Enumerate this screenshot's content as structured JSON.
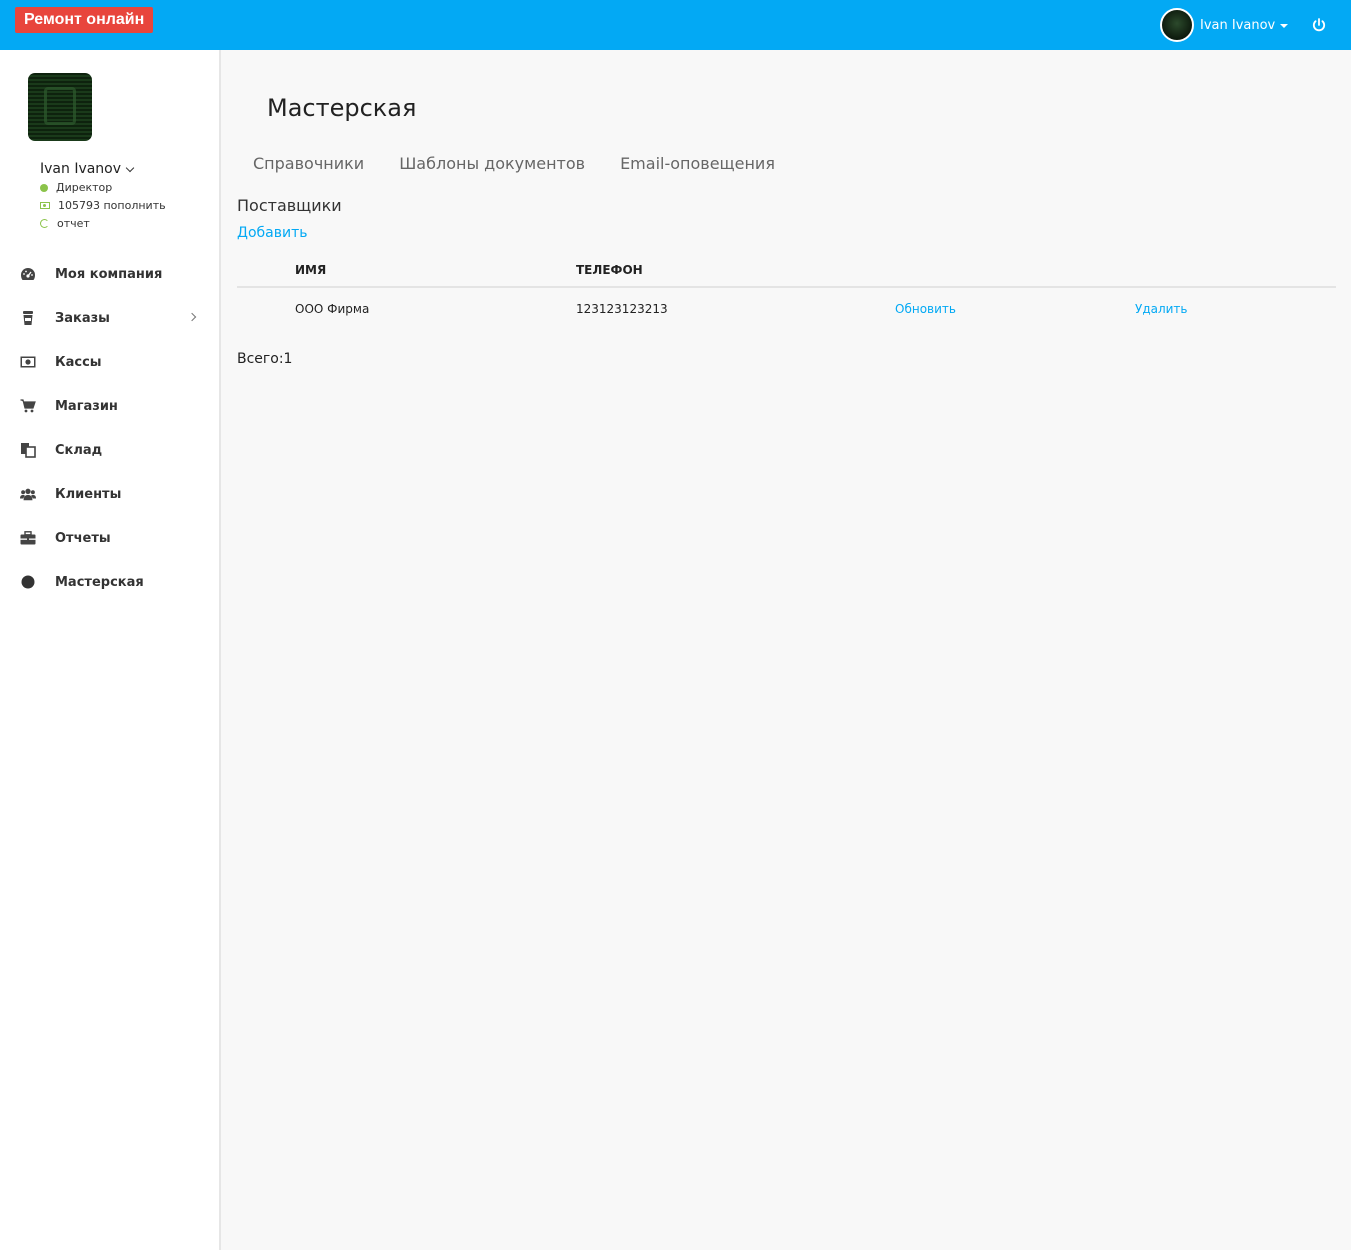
{
  "topbar": {
    "brand": "Ремонт онлайн",
    "user_name": "Ivan Ivanov"
  },
  "sidebar": {
    "user_name": "Ivan Ivanov",
    "role": "Директор",
    "balance": "105793 пополнить",
    "report": "отчет",
    "items": [
      {
        "label": "Моя компания",
        "icon": "dashboard-icon"
      },
      {
        "label": "Заказы",
        "icon": "cup-icon"
      },
      {
        "label": "Кассы",
        "icon": "money-icon"
      },
      {
        "label": "Магазин",
        "icon": "cart-icon"
      },
      {
        "label": "Склад",
        "icon": "copy-icon"
      },
      {
        "label": "Клиенты",
        "icon": "users-icon"
      },
      {
        "label": "Отчеты",
        "icon": "briefcase-icon"
      },
      {
        "label": "Мастерская",
        "icon": "circle-icon"
      }
    ]
  },
  "main": {
    "title": "Мастерская",
    "tabs": [
      "Справочники",
      "Шаблоны документов",
      "Email-оповещения"
    ],
    "section_title": "Поставщики",
    "add_label": "Добавить",
    "table": {
      "headers": [
        "ИМЯ",
        "ТЕЛЕФОН"
      ],
      "rows": [
        {
          "name": "ООО Фирма",
          "phone": "123123123213",
          "update": "Обновить",
          "delete": "Удалить"
        }
      ]
    },
    "total": "Всего:1"
  },
  "colors": {
    "topbar": "#03a9f4",
    "brand": "#e8453c",
    "link": "#03a9f4",
    "status": "#8bc34a"
  }
}
